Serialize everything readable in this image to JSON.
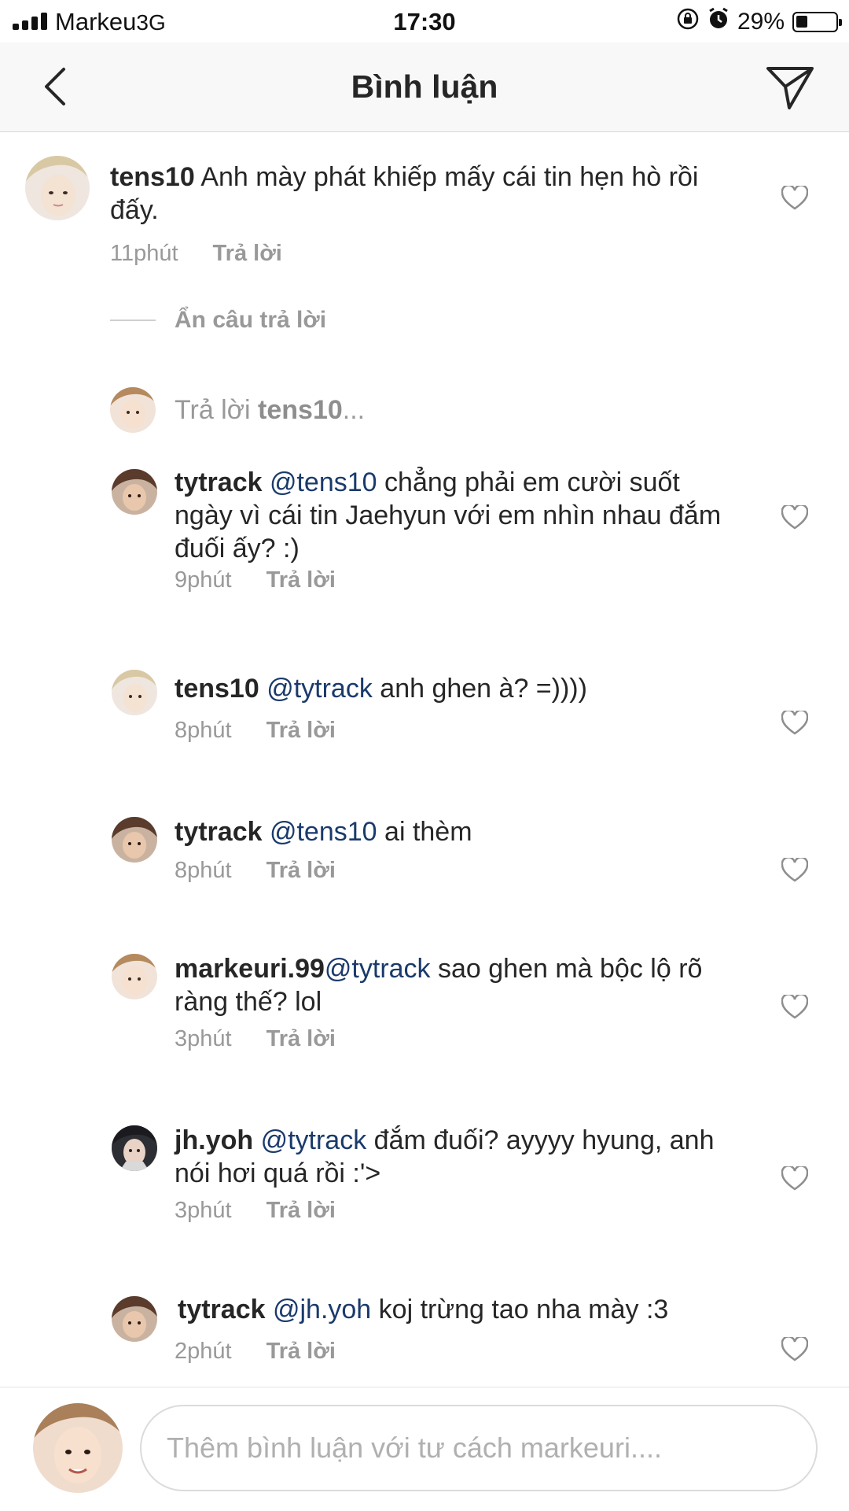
{
  "status_bar": {
    "carrier": "Markeu",
    "network": "3G",
    "time": "17:30",
    "battery_percent": "29%",
    "battery_level": 0.29
  },
  "nav": {
    "title": "Bình luận",
    "back_icon": "chevron-left-icon",
    "share_icon": "paper-plane-icon"
  },
  "main_comment": {
    "username": "tens10",
    "text": "Anh mày phát khiếp mấy cái tin hẹn hò rồi đấy.",
    "time": "11phút",
    "reply_label": "Trả lời"
  },
  "hide_replies_label": "Ẩn câu trả lời",
  "reply_prompt": {
    "prefix": "Trả lời",
    "username": "tens10",
    "suffix": "..."
  },
  "replies": [
    {
      "username": "tytrack",
      "mention": "@tens10",
      "text": "chẳng phải em cười suốt ngày vì cái tin Jaehyun với em nhìn nhau đắm đuối ấy? :)",
      "time": "9phút",
      "reply_label": "Trả lời"
    },
    {
      "username": "tens10",
      "mention": "@tytrack",
      "text": "anh ghen à? =))))",
      "time": "8phút",
      "reply_label": "Trả lời"
    },
    {
      "username": "tytrack",
      "mention": "@tens10",
      "text": "ai thèm",
      "time": "8phút",
      "reply_label": "Trả lời"
    },
    {
      "username": "markeuri.99",
      "mention": "@tytrack",
      "text": "sao ghen mà bộc lộ rõ ràng thế? lol",
      "time": "3phút",
      "reply_label": "Trả lời"
    },
    {
      "username": "jh.yoh",
      "mention": "@tytrack",
      "text": "đắm đuối? ayyyy hyung, anh nói hơi quá rồi :'>",
      "time": "3phút",
      "reply_label": "Trả lời"
    },
    {
      "username": "tytrack",
      "mention": "@jh.yoh",
      "text": "koj trừng tao nha mày :3",
      "time": "2phút",
      "reply_label": "Trả lời"
    }
  ],
  "composer": {
    "placeholder": "Thêm bình luận với tư cách markeuri...."
  },
  "colors": {
    "text": "#262626",
    "muted": "#999999",
    "mention": "#1a3a6b",
    "nav_bg": "#f8f8f8"
  }
}
